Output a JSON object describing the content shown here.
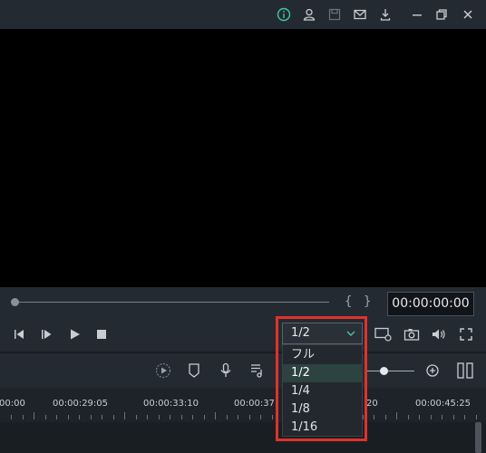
{
  "titlebar": {
    "icons": [
      "info-icon",
      "user-icon",
      "save-icon",
      "mail-icon",
      "download-icon",
      "minimize-icon",
      "restore-icon",
      "close-icon"
    ]
  },
  "preview": {
    "timecode": "00:00:00:00",
    "mark_in": "{",
    "mark_out": "}"
  },
  "playback": {
    "icons": [
      "prev-frame-icon",
      "next-frame-icon",
      "play-icon",
      "stop-icon"
    ],
    "resolution": {
      "selected": "1/2",
      "options": [
        "フル",
        "1/2",
        "1/4",
        "1/8",
        "1/16"
      ],
      "accent": "#e0322b"
    },
    "right_icons": [
      "display-settings-icon",
      "snapshot-icon",
      "volume-icon",
      "fullscreen-icon"
    ]
  },
  "toolbar": {
    "icons": [
      "render-preview-icon",
      "marker-icon",
      "microphone-icon",
      "audio-mixer-icon",
      "zoom-in-icon",
      "pause-columns-icon"
    ]
  },
  "timeline": {
    "ticks": [
      "00:00",
      "00:00:29:05",
      "00:00:33:10",
      "00:00:37:",
      "20",
      "00:00:45:25"
    ]
  }
}
